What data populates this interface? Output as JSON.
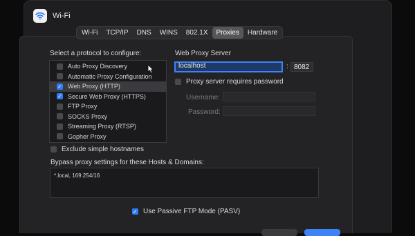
{
  "window": {
    "title": "Wi-Fi",
    "icon": "wifi-icon"
  },
  "tabs": [
    {
      "label": "Wi-Fi",
      "active": false
    },
    {
      "label": "TCP/IP",
      "active": false
    },
    {
      "label": "DNS",
      "active": false
    },
    {
      "label": "WINS",
      "active": false
    },
    {
      "label": "802.1X",
      "active": false
    },
    {
      "label": "Proxies",
      "active": true
    },
    {
      "label": "Hardware",
      "active": false
    }
  ],
  "protocols": {
    "heading": "Select a protocol to configure:",
    "items": [
      {
        "label": "Auto Proxy Discovery",
        "checked": false,
        "selected": false
      },
      {
        "label": "Automatic Proxy Configuration",
        "checked": false,
        "selected": false
      },
      {
        "label": "Web Proxy (HTTP)",
        "checked": true,
        "selected": true
      },
      {
        "label": "Secure Web Proxy (HTTPS)",
        "checked": true,
        "selected": false
      },
      {
        "label": "FTP Proxy",
        "checked": false,
        "selected": false
      },
      {
        "label": "SOCKS Proxy",
        "checked": false,
        "selected": false
      },
      {
        "label": "Streaming Proxy (RTSP)",
        "checked": false,
        "selected": false
      },
      {
        "label": "Gopher Proxy",
        "checked": false,
        "selected": false
      }
    ]
  },
  "server": {
    "heading": "Web Proxy Server",
    "host": "localhost",
    "separator": ":",
    "port": "8082",
    "requires_password_label": "Proxy server requires password",
    "username_label": "Username:",
    "password_label": "Password:"
  },
  "exclude_simple_label": "Exclude simple hostnames",
  "bypass": {
    "heading": "Bypass proxy settings for these Hosts & Domains:",
    "value": "*.local, 169.254/16"
  },
  "passive_ftp_label": "Use Passive FTP Mode (PASV)",
  "colors": {
    "accent": "#2f7cf6",
    "background": "#1e1e20"
  }
}
